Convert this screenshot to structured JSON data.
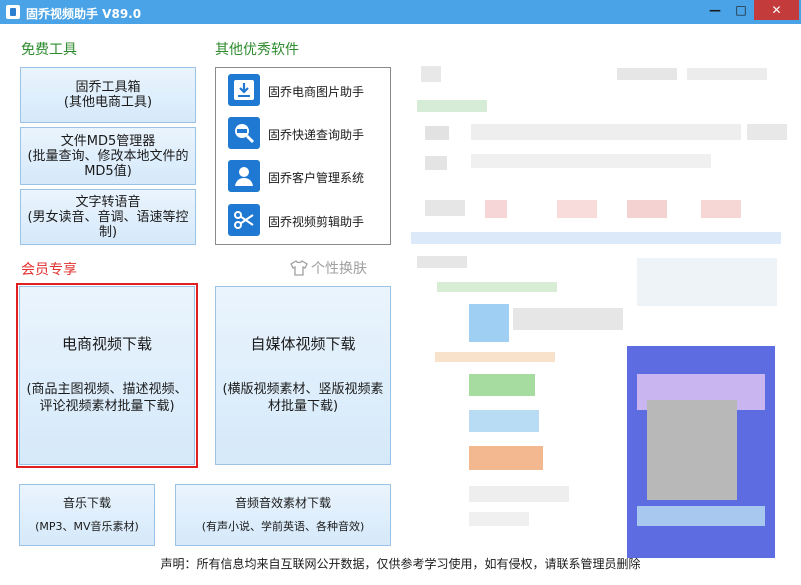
{
  "window": {
    "title": "固乔视频助手 V89.0",
    "minimize": "—",
    "maximize": "□",
    "close": "✕"
  },
  "free_tools": {
    "heading": "免费工具",
    "items": [
      {
        "main": "固乔工具箱",
        "sub": "(其他电商工具)"
      },
      {
        "main": "文件MD5管理器",
        "sub": "(批量查询、修改本地文件的MD5值)"
      },
      {
        "main": "文字转语音",
        "sub": "(男女读音、音调、语速等控制)"
      }
    ]
  },
  "other_software": {
    "heading": "其他优秀软件",
    "items": [
      {
        "label": "固乔电商图片助手",
        "icon": "download-icon"
      },
      {
        "label": "固乔快递查询助手",
        "icon": "express-search-icon"
      },
      {
        "label": "固乔客户管理系统",
        "icon": "customer-icon"
      },
      {
        "label": "固乔视频剪辑助手",
        "icon": "scissors-icon"
      }
    ]
  },
  "vip": {
    "heading": "会员专享",
    "skin_label": "个性换肤",
    "ecommerce": {
      "main": "电商视频下载",
      "sub": "(商品主图视频、描述视频、评论视频素材批量下载)"
    },
    "media": {
      "main": "自媒体视频下载",
      "sub": "(横版视频素材、竖版视频素材批量下载)"
    }
  },
  "bottom": {
    "music": {
      "main": "音乐下载",
      "sub": "(MP3、MV音乐素材)"
    },
    "audio": {
      "main": "音频音效素材下载",
      "sub": "(有声小说、学前英语、各种音效)"
    }
  },
  "footer": "声明：所有信息均来自互联网公开数据，仅供参考学习使用，如有侵权，请联系管理员删除",
  "colors": {
    "titlebar": "#4aa3e6",
    "button_border": "#9cc2e6",
    "section_green": "#2e8b2e",
    "section_red": "#e03030",
    "selection": "#e02020"
  }
}
